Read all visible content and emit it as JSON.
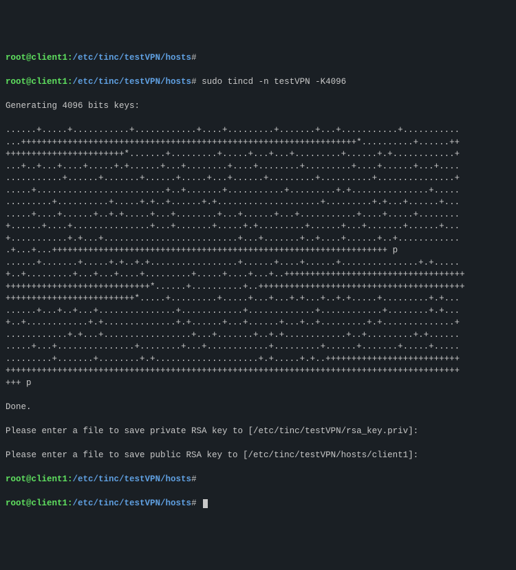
{
  "prompt": {
    "user": "root@client1",
    "colon": ":",
    "path": "/etc/tinc/testVPN/hosts",
    "hash": "#"
  },
  "command": "sudo tincd -n testVPN -K4096",
  "generating": "Generating 4096 bits keys:",
  "keygen_lines": [
    "......+.....+...........+............+....+.........+.......+...+...........+...........",
    "...+++++++++++++++++++++++++++++++++++++++++++++++++++++++++++++++++*..........+......++",
    "+++++++++++++++++++++++*.......+.........+.....+...+...+.........+......+.+............+",
    "...+..+...+....+.....+.+......+...+........+....+........+.........+....+......+...+....",
    "...........+......+.......+......+.....+...+......+.........+..........+...............+",
    ".....+.........................+..+.......+...........+.........+.+...............+.....",
    ".........+..........+.....+.+..+......+.+....................+.........+.+...+......+...",
    ".....+....+......+..+.+.....+...+........+...+......+...+...........+....+.....+........",
    "+......+....+...............+...+.......+.....+.+.........+......+...+.......+......+...",
    "+...........+.+...+..........................+...+.......+..+....+......+..+............",
    ".+...+...+++++++++++++++++++++++++++++++++++++++++++++++++++++++++++++++++ p",
    "......+.......+.....+.+..+.+.................+......+....+......+...............+.+.....",
    "+..+.........+...+...+....+.........+.....+....+...+..+++++++++++++++++++++++++++++++++++",
    "++++++++++++++++++++++++++++*......+..........+..++++++++++++++++++++++++++++++++++++++++",
    "+++++++++++++++++++++++++*.....+.........+.....+...+...+.+...+..+.+.....+.........+.+...",
    "......+...+..+...+...............+............+.............+............+........+.+...",
    "+..+............+.+..............+.+......+...+......+...+..+.........+.+..............+",
    "............+.+...+.................+...+.......+..+.+............+..+.........+.+......",
    ".....+...+...............+........+...+............+.........+......+.......+.....+.....",
    ".........+.......+........+.+....................+.+.....+.+..++++++++++++++++++++++++++",
    "++++++++++++++++++++++++++++++++++++++++++++++++++++++++++++++++++++++++++++++++++++++++",
    "+++ p"
  ],
  "done": "Done.",
  "prompt_priv": "Please enter a file to save private RSA key to [/etc/tinc/testVPN/rsa_key.priv]:",
  "prompt_pub": "Please enter a file to save public RSA key to [/etc/tinc/testVPN/hosts/client1]:"
}
